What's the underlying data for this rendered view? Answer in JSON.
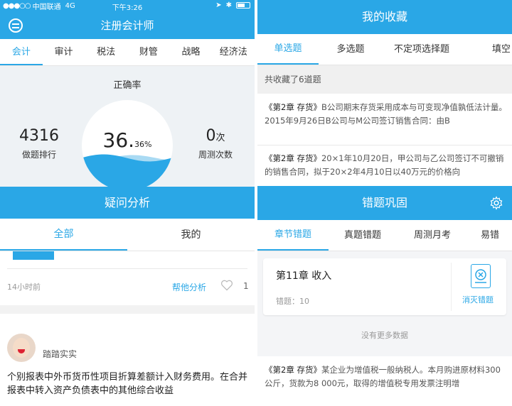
{
  "colors": {
    "accent": "#2aa7e6",
    "panel_bg": "#eef2f5"
  },
  "left": {
    "status": {
      "carrier": "中国联通",
      "network": "4G",
      "time": "下午3:26"
    },
    "title": "注册会计师",
    "subjects": [
      "会计",
      "审计",
      "税法",
      "财管",
      "战略",
      "经济法"
    ],
    "stats": {
      "accuracy_label": "正确率",
      "accuracy_main": "36.",
      "accuracy_decimal": "36%",
      "accuracy_fraction": 0.3636,
      "rank_value": "4316",
      "rank_label": "做题排行",
      "weekly_value": "0",
      "weekly_unit": "次",
      "weekly_label": "周测次数"
    },
    "qa": {
      "banner": "疑问分析",
      "tabs": [
        "全部",
        "我的"
      ],
      "post": {
        "time": "14小时前",
        "help_label": "帮他分析",
        "likes": "1"
      },
      "second_post": {
        "user": "踏踏实实",
        "body": "个别报表中外币货币性项目折算差额计入财务费用。在合并报表中转入资产负债表中的其他综合收益"
      }
    }
  },
  "favorites": {
    "title": "我的收藏",
    "tabs": [
      "单选题",
      "多选题",
      "不定项选择题",
      "填空"
    ],
    "count_text": "共收藏了6道题",
    "items": [
      {
        "chapter": "《第2章 存货》",
        "text": "B公司期末存货采用成本与可变现净值孰低法计量。2015年9月26日B公司与M公司签订销售合同：由B"
      },
      {
        "chapter": "《第2章 存货》",
        "text": "20×1年10月20日，甲公司与乙公司签订不可撤销的销售合同，拟于20×2年4月10日以40万元的价格向"
      }
    ]
  },
  "mistakes": {
    "title": "错题巩固",
    "tabs": [
      "章节错题",
      "真题错题",
      "周测月考",
      "易错"
    ],
    "card": {
      "chapter": "第11章 收入",
      "count_label": "错题：10",
      "action": "消灭错题"
    },
    "no_more": "没有更多数据",
    "preview": {
      "chapter": "《第2章 存货》",
      "text": "某企业为增值税一般纳税人。本月购进原材料300公斤，货款为8 000元，取得的增值税专用发票注明增"
    }
  }
}
